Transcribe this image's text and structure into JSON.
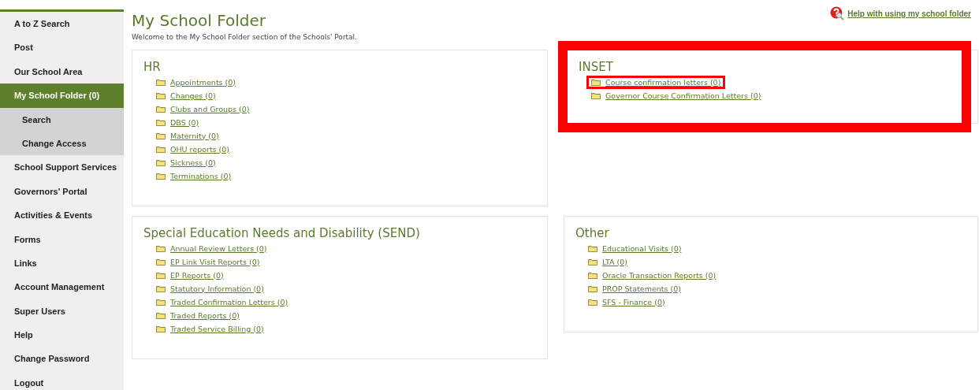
{
  "sidebar": {
    "items": [
      {
        "label": "A to Z Search",
        "selected": false
      },
      {
        "label": "Post",
        "selected": false
      },
      {
        "label": "Our School Area",
        "selected": false
      },
      {
        "label": "My School Folder (0)",
        "selected": true,
        "children": [
          {
            "label": "Search",
            "selected": false
          },
          {
            "label": "Change Access",
            "selected": false
          }
        ]
      },
      {
        "label": "School Support Services",
        "selected": false
      },
      {
        "label": "Governors' Portal",
        "selected": false
      },
      {
        "label": "Activities & Events",
        "selected": false
      },
      {
        "label": "Forms",
        "selected": false
      },
      {
        "label": "Links",
        "selected": false
      },
      {
        "label": "Account Management",
        "selected": false
      },
      {
        "label": "Super Users",
        "selected": false
      },
      {
        "label": "Help",
        "selected": false
      },
      {
        "label": "Change Password",
        "selected": false
      },
      {
        "label": "Logout",
        "selected": false
      }
    ]
  },
  "page": {
    "title": "My School Folder",
    "intro": "Welcome to the My School Folder section of the Schools' Portal.",
    "help_link": "Help with using my school folder"
  },
  "panels": [
    {
      "title": "HR",
      "highlighted": false,
      "folders": [
        {
          "label": "Appointments (0)",
          "highlighted": false
        },
        {
          "label": "Changes (0)",
          "highlighted": false
        },
        {
          "label": "Clubs and Groups (0)",
          "highlighted": false
        },
        {
          "label": "DBS (0)",
          "highlighted": false
        },
        {
          "label": "Maternity (0)",
          "highlighted": false
        },
        {
          "label": "OHU reports (0)",
          "highlighted": false
        },
        {
          "label": "Sickness (0)",
          "highlighted": false
        },
        {
          "label": "Terminations (0)",
          "highlighted": false
        }
      ]
    },
    {
      "title": "INSET",
      "highlighted": true,
      "folders": [
        {
          "label": "Course confirmation letters (0)",
          "highlighted": true
        },
        {
          "label": "Governor Course Confirmation Letters (0)",
          "highlighted": false
        }
      ]
    },
    {
      "title": "Special Education Needs and Disability (SEND)",
      "highlighted": false,
      "folders": [
        {
          "label": "Annual Review Letters (0)",
          "highlighted": false
        },
        {
          "label": "EP Link Visit Reports (0)",
          "highlighted": false
        },
        {
          "label": "EP Reports (0)",
          "highlighted": false
        },
        {
          "label": "Statutory Information (0)",
          "highlighted": false
        },
        {
          "label": "Traded Confirmation Letters (0)",
          "highlighted": false
        },
        {
          "label": "Traded Reports (0)",
          "highlighted": false
        },
        {
          "label": "Traded Service Billing (0)",
          "highlighted": false
        }
      ]
    },
    {
      "title": "Other",
      "highlighted": false,
      "folders": [
        {
          "label": "Educational Visits (0)",
          "highlighted": false
        },
        {
          "label": "LTA (0)",
          "highlighted": false
        },
        {
          "label": "Oracle Transaction Reports (0)",
          "highlighted": false
        },
        {
          "label": "PROP Statements (0)",
          "highlighted": false
        },
        {
          "label": "SFS - Finance (0)",
          "highlighted": false
        }
      ]
    }
  ]
}
